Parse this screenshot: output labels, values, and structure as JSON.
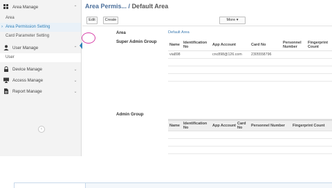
{
  "sidebar": {
    "groups": [
      {
        "label": "Area Manage",
        "icon": "grid-icon",
        "expanded": true,
        "items": [
          {
            "label": "Area",
            "active": false
          },
          {
            "label": "Area Permission Setting",
            "active": true
          },
          {
            "label": "Card Parameter Setting",
            "active": false
          }
        ]
      },
      {
        "label": "User Manage",
        "icon": "user-icon",
        "expanded": true,
        "items": [
          {
            "label": "User",
            "active": false
          }
        ]
      },
      {
        "label": "Device Manage",
        "icon": "lock-icon",
        "expanded": false,
        "items": []
      },
      {
        "label": "Access Manage",
        "icon": "monitor-icon",
        "expanded": false,
        "items": []
      },
      {
        "label": "Report Manage",
        "icon": "report-icon",
        "expanded": false,
        "items": []
      }
    ],
    "collapse_glyph": "‹"
  },
  "header": {
    "breadcrumb_parent": "Area Permis... /",
    "breadcrumb_current": "Default Area"
  },
  "toolbar": {
    "edit_label": "Edit",
    "create_label": "Create",
    "more_label": "More ▾"
  },
  "form": {
    "area_label": "Area",
    "area_value": "Default Area",
    "super_admin_label": "Super Admin Group",
    "admin_label": "Admin Group"
  },
  "super_admin_table": {
    "columns": [
      "Name",
      "Identification No",
      "App Account",
      "Card No",
      "Personnel Number",
      "Fingerprint Count"
    ],
    "rows": [
      [
        "via898",
        "",
        "cnc898@126.com",
        "2305558796",
        "",
        ""
      ]
    ]
  },
  "admin_table": {
    "columns": [
      "Name",
      "Identification No",
      "App Account",
      "Card No",
      "Personnel Number",
      "Fingerprint Count"
    ],
    "rows": []
  },
  "colors": {
    "accent": "#2e7fb8",
    "highlight_circle": "#d63ca6"
  }
}
